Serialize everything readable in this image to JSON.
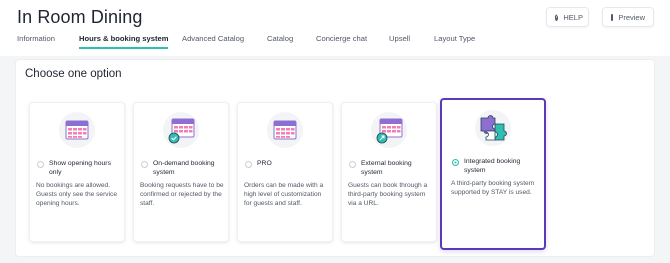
{
  "header": {
    "title": "In Room Dining",
    "help_label": "HELP",
    "preview_label": "Preview"
  },
  "tabs": [
    {
      "label": "Information",
      "active": false
    },
    {
      "label": "Hours & booking system",
      "active": true
    },
    {
      "label": "Advanced Catalog",
      "active": false
    },
    {
      "label": "Catalog",
      "active": false
    },
    {
      "label": "Concierge chat",
      "active": false
    },
    {
      "label": "Upsell",
      "active": false
    },
    {
      "label": "Layout Type",
      "active": false
    }
  ],
  "panel": {
    "title": "Choose one option",
    "options": [
      {
        "label": "Show opening hours only",
        "description": "No bookings are allowed. Guests only see the service opening hours.",
        "icon": "calendar-icon",
        "selected": false
      },
      {
        "label": "On-demand booking system",
        "description": "Booking requests have to be confirmed or rejected by the staff.",
        "icon": "calendar-check-icon",
        "selected": false
      },
      {
        "label": "PRO",
        "description": "Orders can be made with a high level of customization for guests and staff.",
        "icon": "calendar-icon",
        "selected": false
      },
      {
        "label": "External booking system",
        "description": "Guests can book through a third-party booking system via a URL.",
        "icon": "calendar-link-icon",
        "selected": false
      },
      {
        "label": "Integrated booking system",
        "description": "A third-party booking system supported by STAY is used.",
        "icon": "puzzle-icon",
        "selected": true
      }
    ]
  },
  "colors": {
    "accent": "#2fbfb0",
    "selected_border": "#5b3bb5",
    "calendar_purple": "#8e6fd1",
    "calendar_grid": "#f07fb4"
  }
}
